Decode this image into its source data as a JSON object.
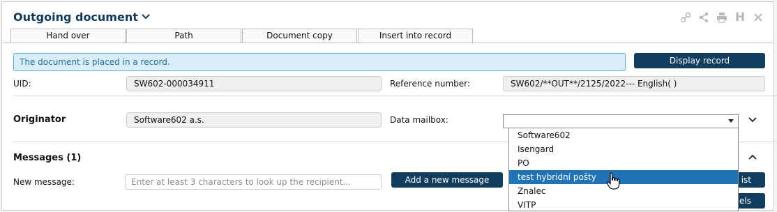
{
  "header": {
    "title": "Outgoing document"
  },
  "tabs": [
    "Hand over",
    "Path",
    "Document copy",
    "Insert into record"
  ],
  "toolbar_icons": [
    "link-icon",
    "share-icon",
    "print-icon",
    "h-icon",
    "close-icon"
  ],
  "toolbar": {
    "h_label": "H"
  },
  "info_message": "The document is placed in a record.",
  "buttons": {
    "display_record": "Display record",
    "add_new_message": "Add a new message",
    "right_partial_1": "ist",
    "right_partial_2": "els"
  },
  "fields": {
    "uid": {
      "label": "UID:",
      "value": "SW602-000034911"
    },
    "reference": {
      "label": "Reference number:",
      "value": "SW602/**OUT**/2125/2022--- English( )"
    },
    "originator": {
      "label": "Originator",
      "value": "Software602 a.s."
    },
    "data_mailbox": {
      "label": "Data mailbox:",
      "value": ""
    }
  },
  "dropdown": {
    "options": [
      "Software602",
      "Isengard",
      "PO",
      "test hybridní pošty",
      "Znalec",
      "VITP"
    ],
    "highlighted": "test hybridní pošty"
  },
  "messages": {
    "header": "Messages (1)",
    "new_message_label": "New message:",
    "placeholder": "Enter at least 3 characters to look up the recipient..."
  },
  "colors": {
    "primary": "#113d5e",
    "info_bg": "#d9eef8",
    "info_text": "#1f6f9c",
    "highlight": "#1f73b7"
  }
}
